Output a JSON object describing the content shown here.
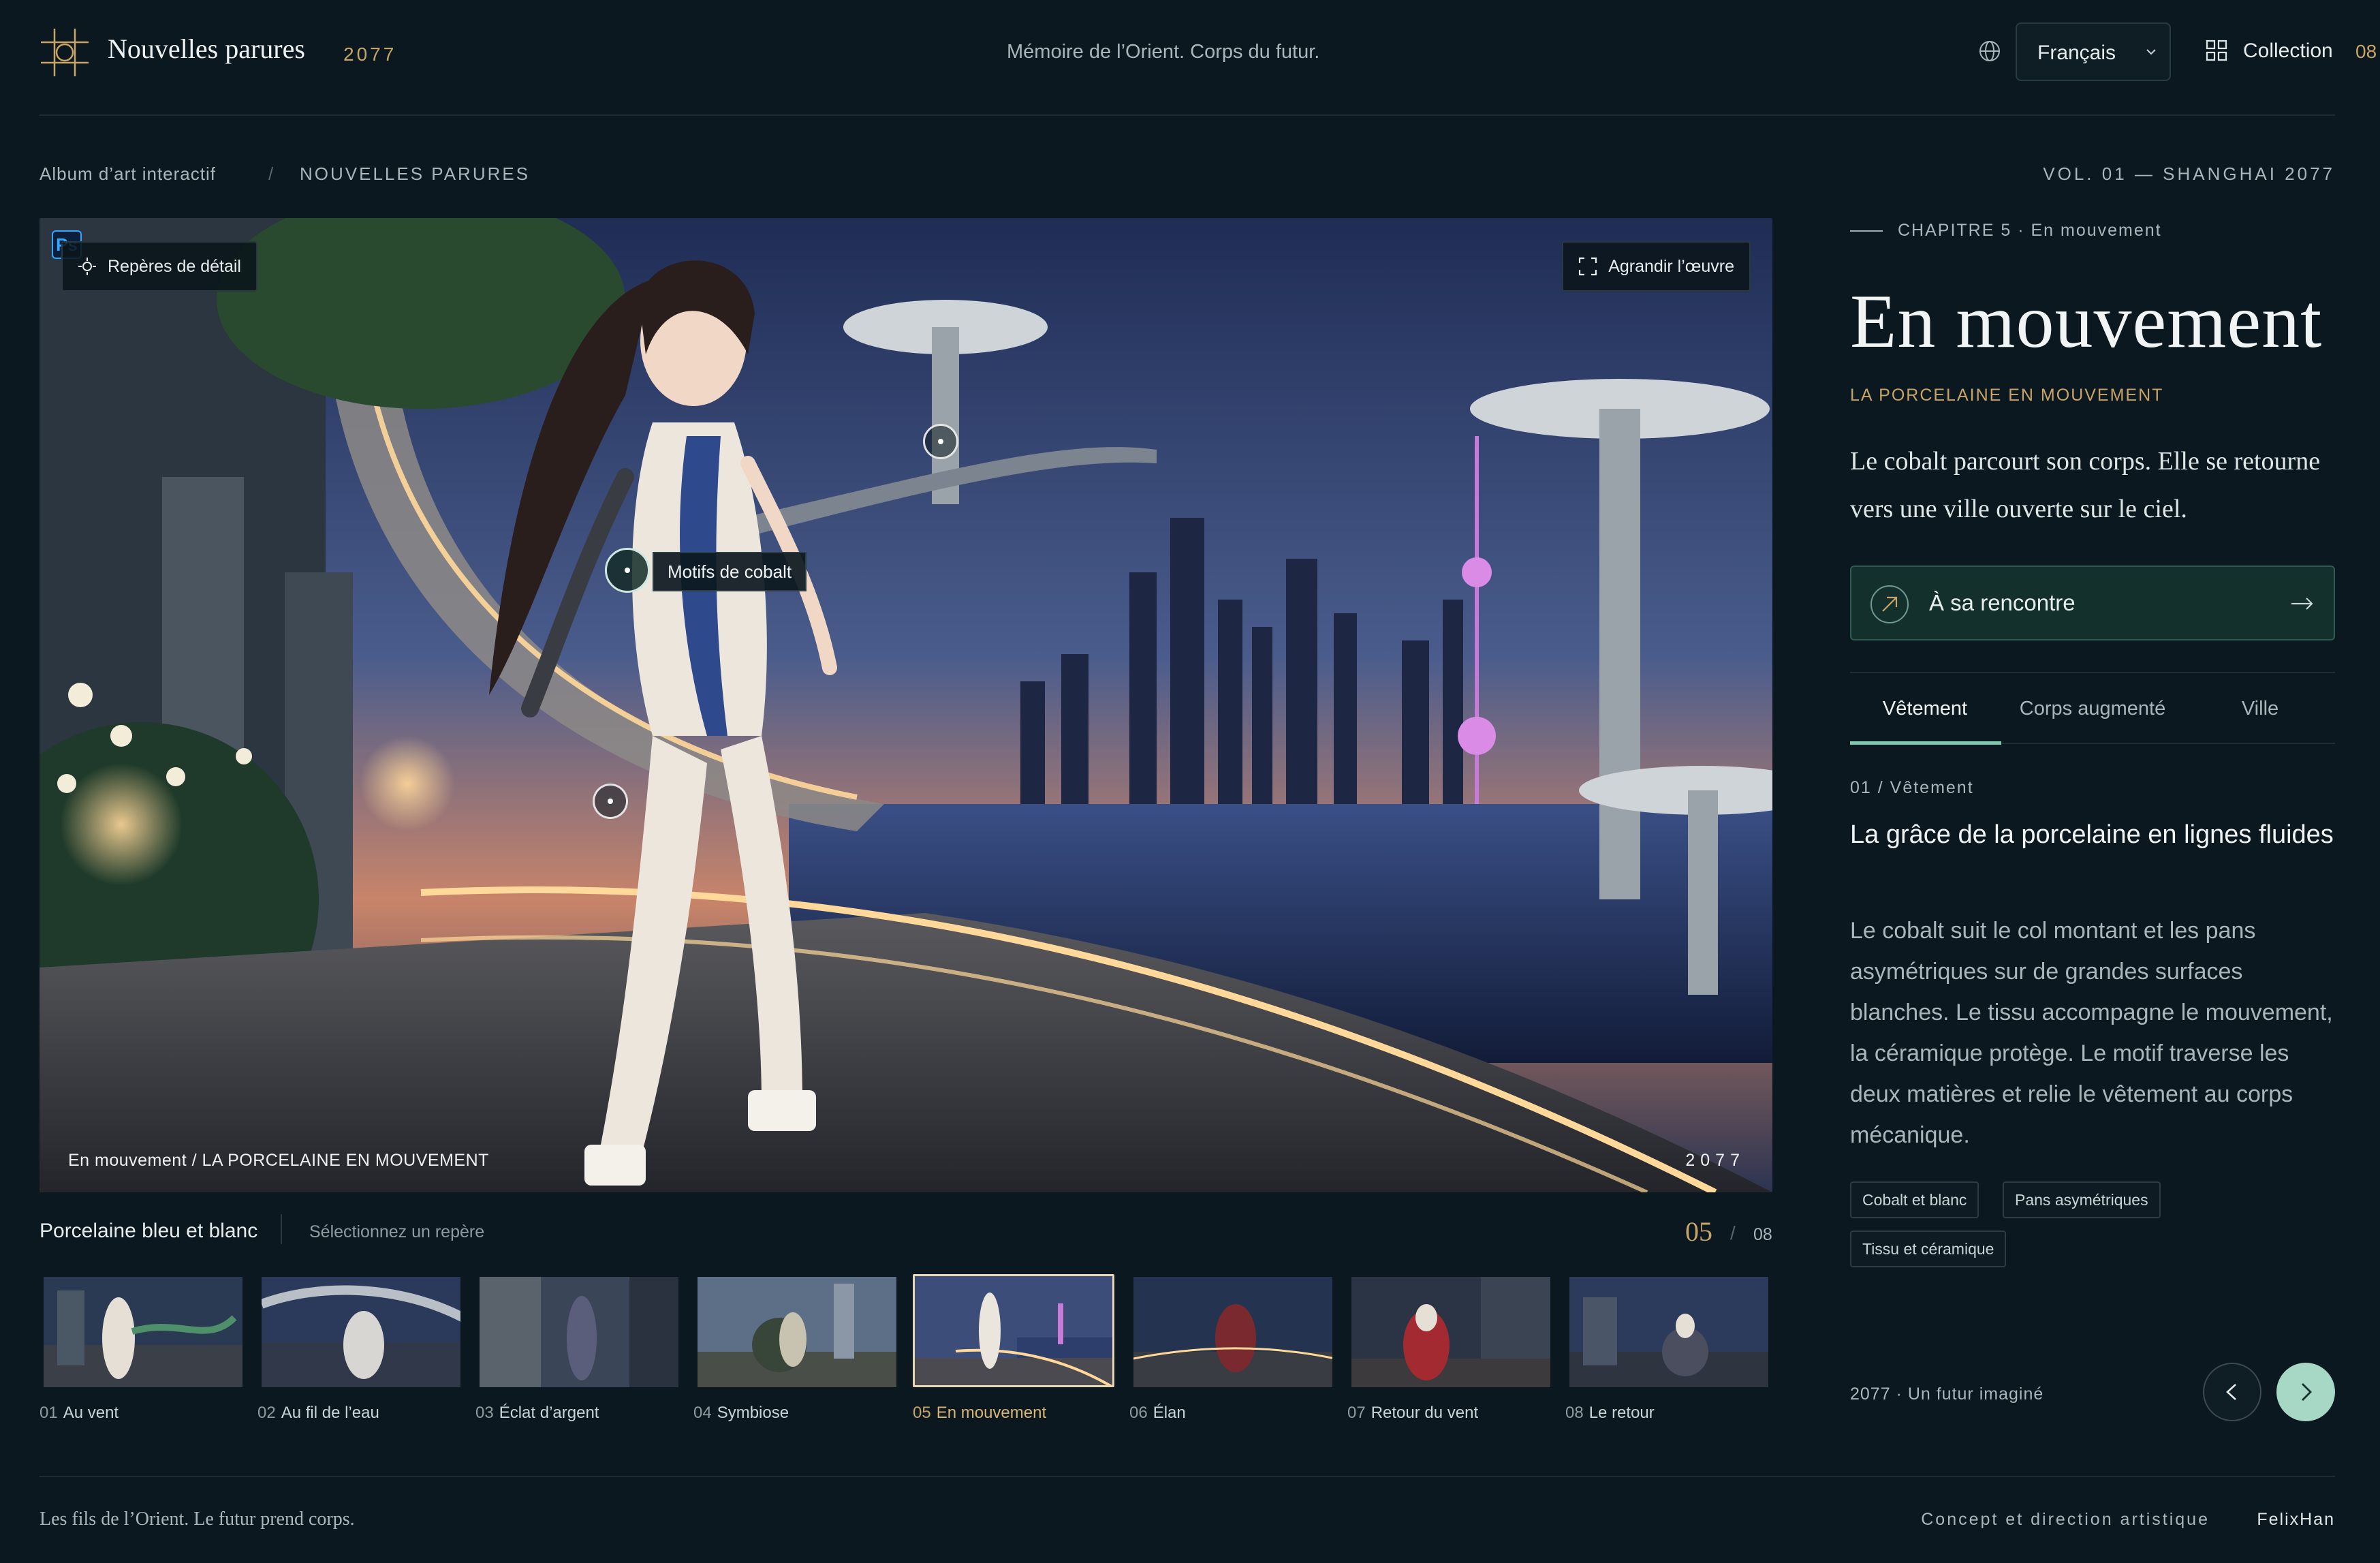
{
  "header": {
    "brand": "Nouvelles parures",
    "brand_year": "2077",
    "tagline": "Mémoire de l’Orient. Corps du futur.",
    "language": "Français",
    "collection_label": "Collection",
    "collection_count": "08"
  },
  "breadcrumb": {
    "root": "Album d’art interactif",
    "separator": "/",
    "current": "NOUVELLES PARURES",
    "volume": "VOL. 01 — SHANGHAI 2077"
  },
  "artwork": {
    "badge": "Ps",
    "details_button": "Repères de détail",
    "enlarge_button": "Agrandir l’œuvre",
    "hotspot_label": "Motifs de cobalt",
    "caption": "En mouvement / LA PORCELAINE EN MOUVEMENT",
    "year": "2077"
  },
  "material": {
    "title": "Porcelaine bleu et blanc",
    "hint": "Sélectionnez un repère",
    "current": "05",
    "separator": "/",
    "total": "08"
  },
  "thumbnails": [
    {
      "num": "01",
      "label": "Au vent"
    },
    {
      "num": "02",
      "label": "Au fil de l’eau"
    },
    {
      "num": "03",
      "label": "Éclat d’argent"
    },
    {
      "num": "04",
      "label": "Symbiose"
    },
    {
      "num": "05",
      "label": "En mouvement"
    },
    {
      "num": "06",
      "label": "Élan"
    },
    {
      "num": "07",
      "label": "Retour du vent"
    },
    {
      "num": "08",
      "label": "Le retour"
    }
  ],
  "panel": {
    "chapter": "CHAPITRE 5 · En mouvement",
    "title": "En mouvement",
    "subtitle": "LA PORCELAINE EN MOUVEMENT",
    "lead": "Le cobalt parcourt son corps. Elle se retourne vers une ville ouverte sur le ciel.",
    "cta": "À sa rencontre",
    "tabs": [
      "Vêtement",
      "Corps augmenté",
      "Ville"
    ],
    "section_label": "01 / Vêtement",
    "section_title": "La grâce de la porcelaine en lignes fluides",
    "section_body": "Le cobalt suit le col montant et les pans asymétriques sur de grandes surfaces blanches. Le tissu accompagne le mouvement, la céramique protège. Le motif traverse les deux matières et relie le vêtement au corps mécanique.",
    "tags": [
      "Cobalt et blanc",
      "Pans asymétriques",
      "Tissu et céramique"
    ],
    "footer_note": "2077 · Un futur imaginé"
  },
  "footer": {
    "left": "Les fils de l’Orient. Le futur prend corps.",
    "credit_label": "Concept et direction artistique",
    "credit_name": "FelixHan"
  },
  "colors": {
    "background": "#0c1820",
    "accent_gold": "#c9a467",
    "accent_mint": "#a7d8c6",
    "cta_bg": "#14302d"
  },
  "icons": {
    "logo": "ornament-grid-icon",
    "language": "globe-icon",
    "collection": "grid-icon",
    "details": "crosshair-icon",
    "enlarge": "expand-icon",
    "cta": "arrow-up-right-icon",
    "prev": "chevron-left-icon",
    "next": "chevron-right-icon"
  }
}
